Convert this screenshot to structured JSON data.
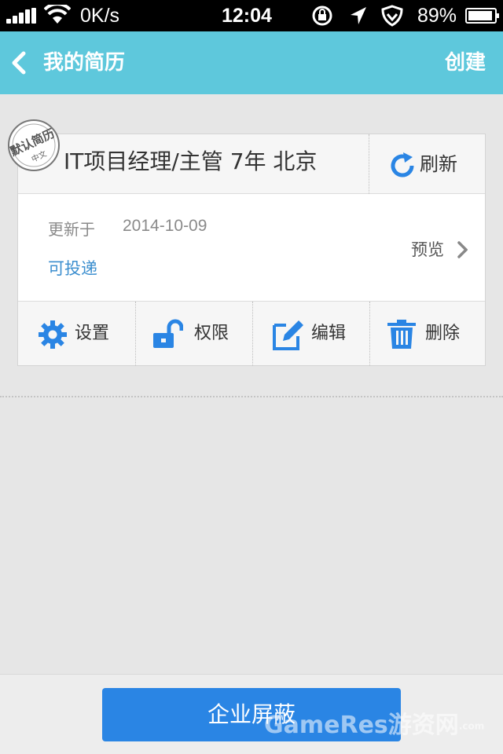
{
  "status_bar": {
    "speed": "0K/s",
    "time": "12:04",
    "battery": "89%"
  },
  "nav": {
    "title": "我的简历",
    "action": "创建"
  },
  "resume": {
    "badge": "默认简历",
    "badge_sub": "中文",
    "title": "IT项目经理/主管 7年 北京",
    "refresh_label": "刷新",
    "updated_label": "更新于",
    "updated_date": "2014-10-09",
    "delivery_status": "可投递",
    "preview_label": "预览",
    "actions": [
      {
        "label": "设置",
        "icon": "gear-icon"
      },
      {
        "label": "权限",
        "icon": "unlock-icon"
      },
      {
        "label": "编辑",
        "icon": "edit-icon"
      },
      {
        "label": "删除",
        "icon": "trash-icon"
      }
    ]
  },
  "bottom": {
    "button_label": "企业屏蔽"
  },
  "watermark": {
    "text": "GameRes游资网",
    "suffix": ".com"
  },
  "colors": {
    "nav_bg": "#5ec8dc",
    "accent_blue": "#2a85e4",
    "link_blue": "#3d8fcf"
  }
}
